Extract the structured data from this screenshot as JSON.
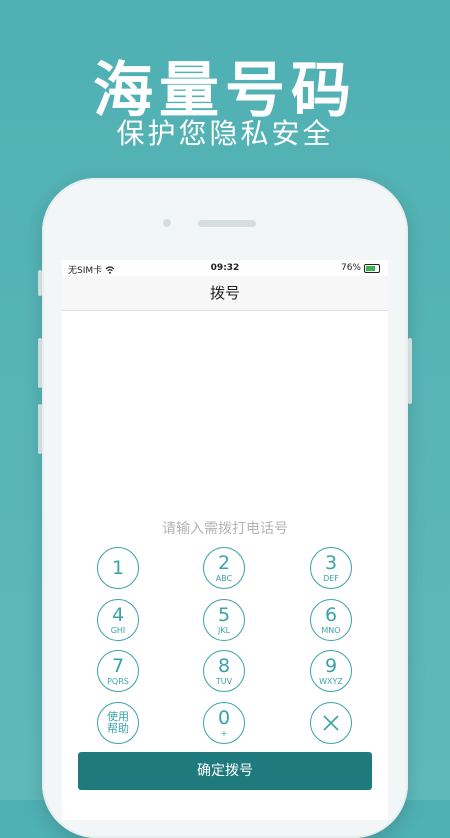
{
  "hero": {
    "title": "海量号码",
    "subtitle": "保护您隐私安全"
  },
  "status": {
    "carrier": "无SIM卡",
    "time": "09:32",
    "battery": "76%"
  },
  "navbar": {
    "title": "拨号"
  },
  "input": {
    "placeholder": "请输入需拨打电话号"
  },
  "keypad": {
    "k1": {
      "digit": "1",
      "letters": ""
    },
    "k2": {
      "digit": "2",
      "letters": "ABC"
    },
    "k3": {
      "digit": "3",
      "letters": "DEF"
    },
    "k4": {
      "digit": "4",
      "letters": "GHI"
    },
    "k5": {
      "digit": "5",
      "letters": "JKL"
    },
    "k6": {
      "digit": "6",
      "letters": "MNO"
    },
    "k7": {
      "digit": "7",
      "letters": "PQRS"
    },
    "k8": {
      "digit": "8",
      "letters": "TUV"
    },
    "k9": {
      "digit": "9",
      "letters": "WXYZ"
    },
    "k0": {
      "digit": "0",
      "letters": "+"
    },
    "help": {
      "line1": "使用",
      "line2": "帮助"
    }
  },
  "actions": {
    "confirm_dial": "确定拨号"
  },
  "colors": {
    "background": "#4fb0b3",
    "accent": "#3aa3a6",
    "button": "#1e7a7c"
  }
}
